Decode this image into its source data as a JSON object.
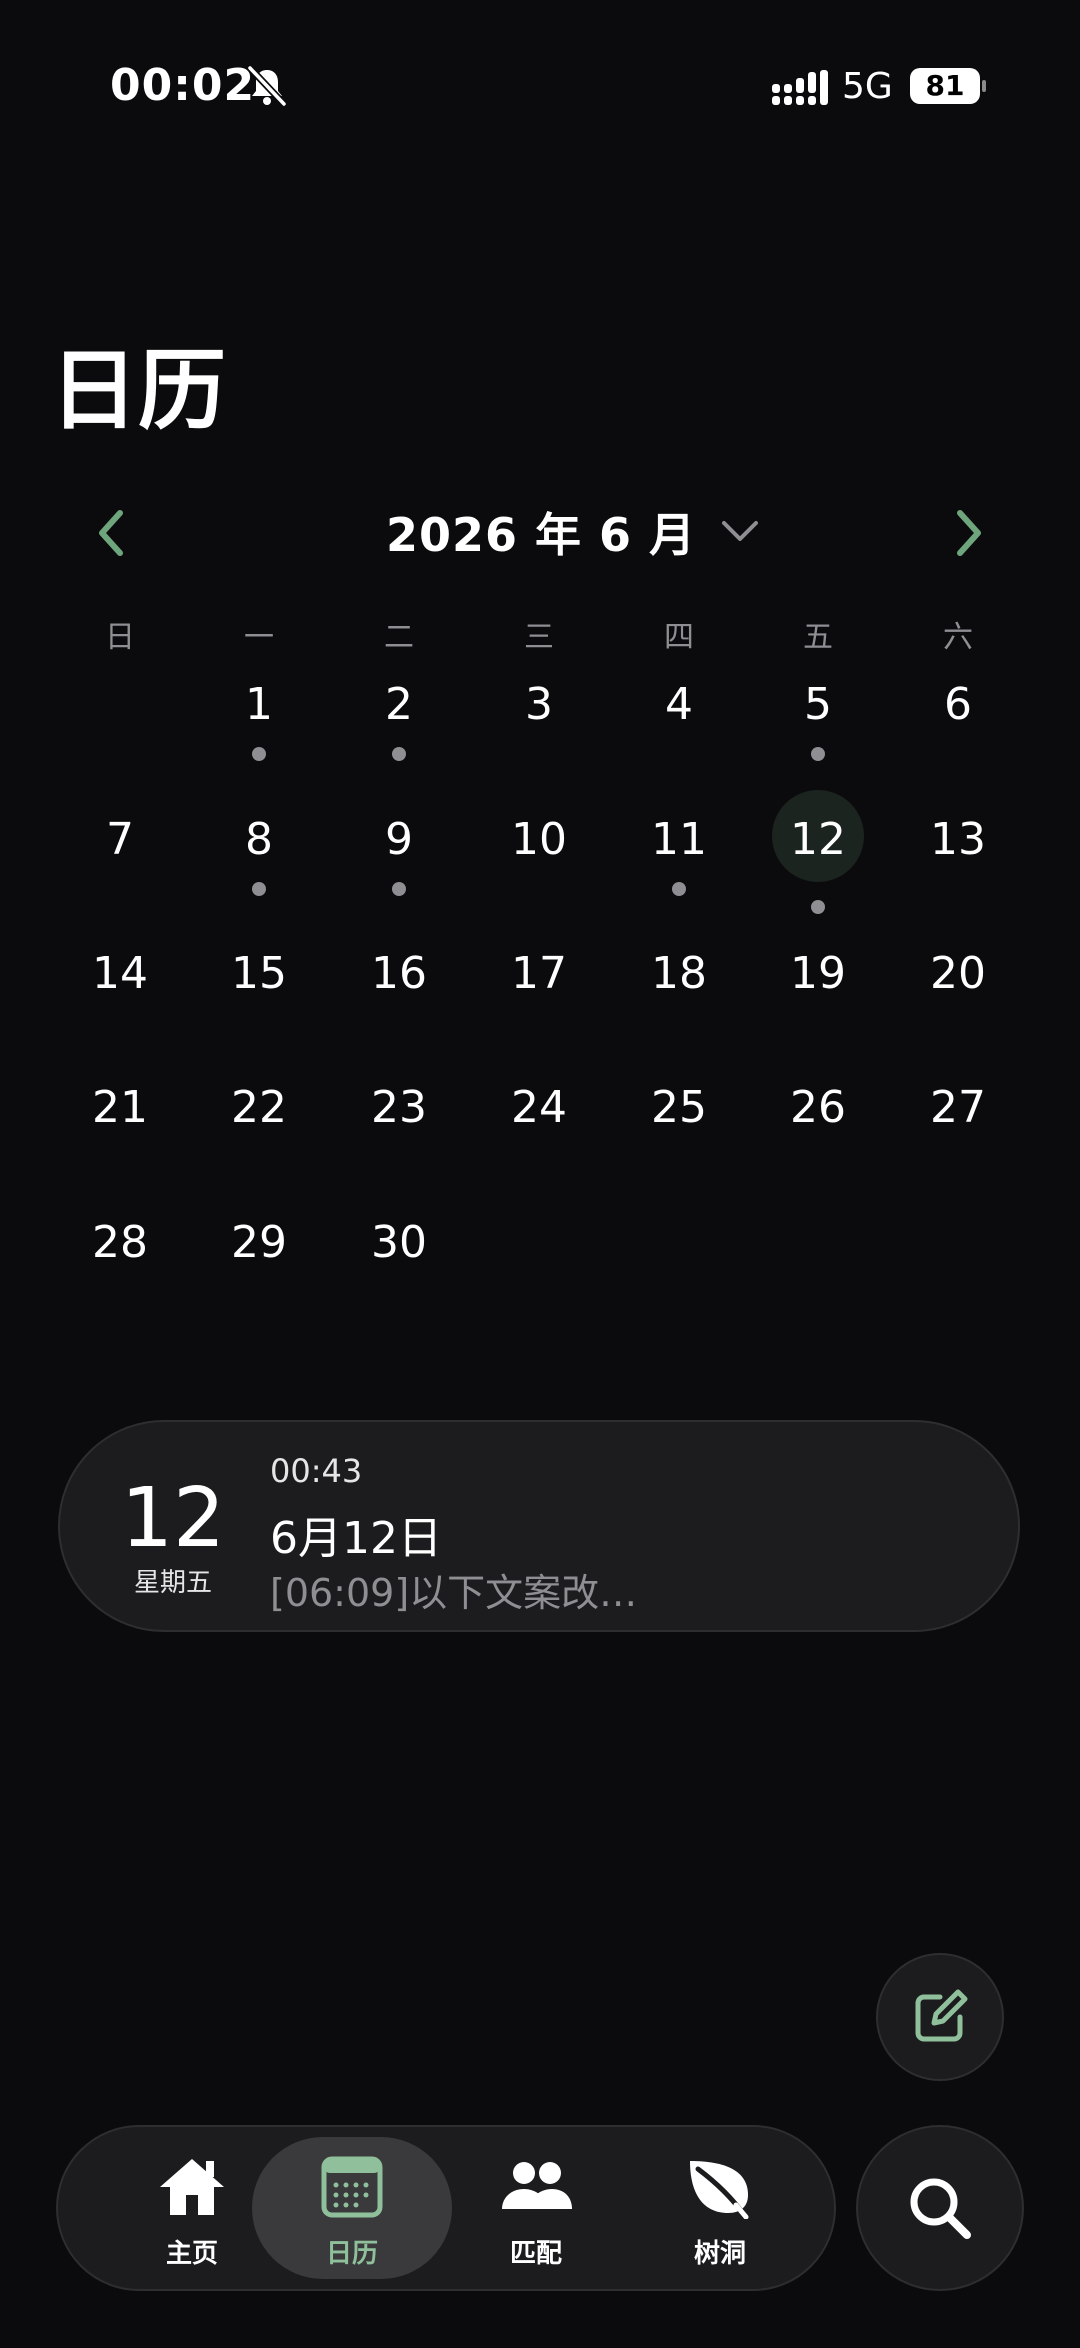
{
  "status_bar": {
    "time": "00:02",
    "network": "5G",
    "battery": "81"
  },
  "page_title": "日历",
  "calendar": {
    "month_label": "2026 年 6 月",
    "weekdays": [
      "日",
      "一",
      "二",
      "三",
      "四",
      "五",
      "六"
    ],
    "first_weekday_index": 1,
    "days_in_month": 30,
    "selected_day": 12,
    "days_with_entries": [
      1,
      2,
      5,
      8,
      9,
      11,
      12
    ]
  },
  "entry": {
    "day": "12",
    "weekday": "星期五",
    "time": "00:43",
    "title": "6月12日",
    "snippet": "[06:09]以下文案改…"
  },
  "tabs": [
    {
      "label": "主页",
      "icon": "home-icon",
      "active": false
    },
    {
      "label": "日历",
      "icon": "calendar-icon",
      "active": true
    },
    {
      "label": "匹配",
      "icon": "people-icon",
      "active": false
    },
    {
      "label": "树洞",
      "icon": "leaf-icon",
      "active": false
    }
  ],
  "colors": {
    "accent": "#8fc09b",
    "background": "#0b0b0d",
    "card": "#1c1c1e",
    "muted": "#8e8e93"
  }
}
